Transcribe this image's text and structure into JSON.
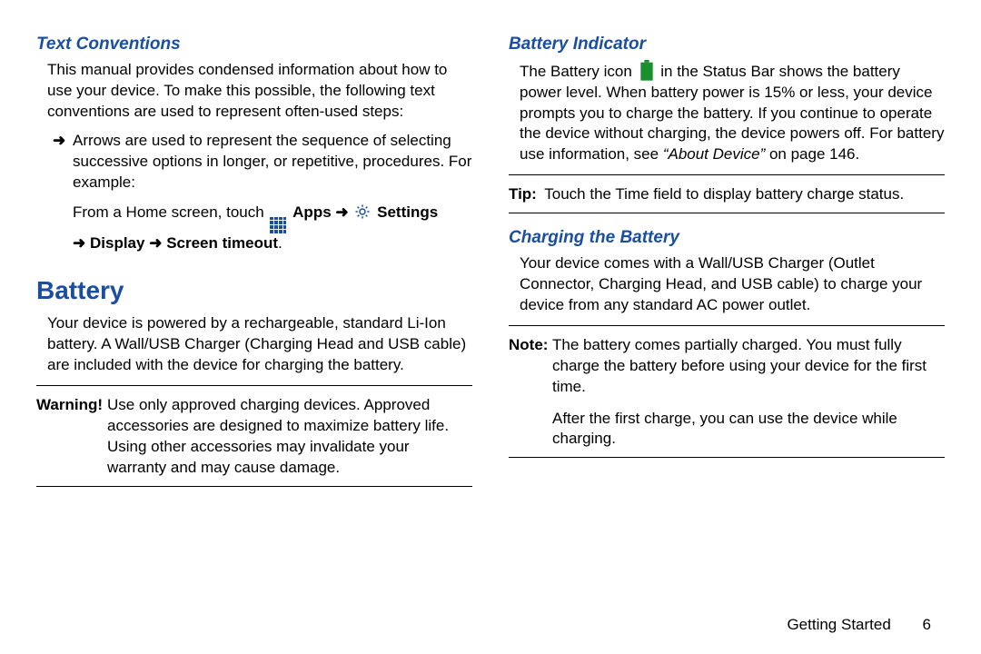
{
  "left": {
    "subhead1": "Text Conventions",
    "para1": "This manual provides condensed information about how to use your device. To make this possible, the following text conventions are used to represent often-used steps:",
    "bullet_arrow": "➜",
    "bullet1": "Arrows are used to represent the sequence of selecting successive options in longer, or repetitive, procedures. For example:",
    "seq_prefix": "From a Home screen, touch ",
    "seq_apps": "Apps",
    "seq_arrow": "➜",
    "seq_settings": "Settings",
    "seq_display": "Display",
    "seq_timeout": "Screen timeout",
    "seq_period": ".",
    "h1": "Battery",
    "para2": "Your device is powered by a rechargeable, standard Li-Ion battery. A Wall/USB Charger (Charging Head and USB cable) are included with the device for charging the battery.",
    "warn_label": "Warning!",
    "warn_text": "Use only approved charging devices. Approved accessories are designed to maximize battery life. Using other accessories may invalidate your warranty and may cause damage."
  },
  "right": {
    "subhead1": "Battery Indicator",
    "para1a": "The Battery icon ",
    "para1b": " in the Status Bar shows the battery power level. When battery power is 15% or less, your device prompts you to charge the battery. If you continue to operate the device without charging, the device powers off. For battery use information, see ",
    "para1c": "“About Device”",
    "para1d": " on page 146.",
    "tip_label": "Tip:",
    "tip_text": " Touch the Time field to display battery charge status.",
    "subhead2": "Charging the Battery",
    "para2": "Your device comes with a Wall/USB Charger (Outlet Connector, Charging Head, and USB cable) to charge your device from any standard AC power outlet.",
    "note_label": "Note:",
    "note_text": "The battery comes partially charged. You must fully charge the battery before using your device for the first time.",
    "after_note": "After the first charge, you can use the device while charging."
  },
  "footer": {
    "section": "Getting Started",
    "page": "6"
  }
}
